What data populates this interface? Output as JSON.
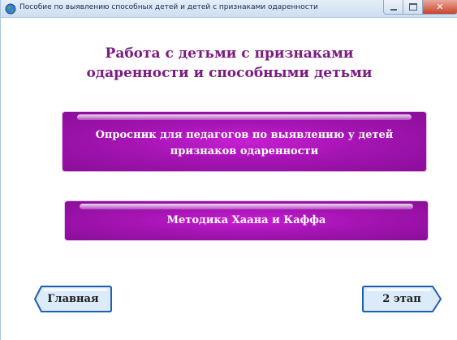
{
  "window": {
    "title": "Пособие по выявлению способных детей и детей с признаками одаренности"
  },
  "heading": {
    "line1": "Работа с детьми с признаками",
    "line2": "одаренности и способными детьми"
  },
  "buttons": {
    "questionnaire": {
      "line1": "Опросник для педагогов по выявлению у детей",
      "line2": "признаков одаренности"
    },
    "method": {
      "label": "Методика Хаана и Каффа"
    }
  },
  "nav": {
    "home_label": "Главная",
    "next_label": "2 этап"
  },
  "colors": {
    "heading": "#7d1a82",
    "button_purple": "#a514b3",
    "nav_fill": "#dcebf9",
    "nav_border": "#1f5fb0"
  }
}
